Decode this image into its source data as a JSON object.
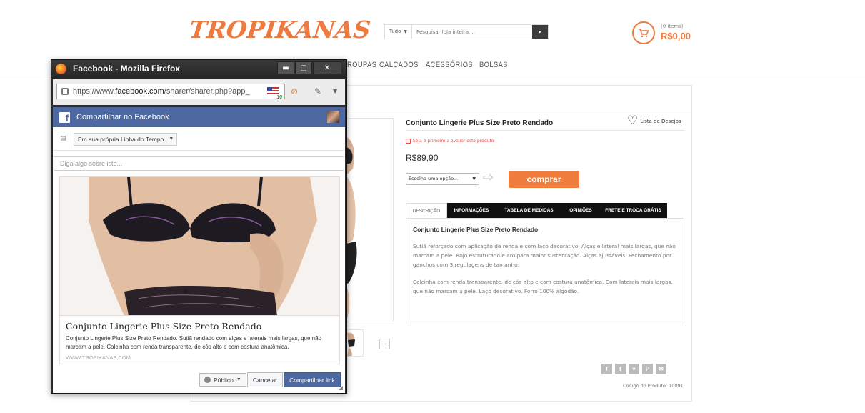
{
  "store": {
    "logo": "TROPIKANAS",
    "search": {
      "category": "Tudo",
      "placeholder": "Pesquisar loja inteira ..."
    },
    "cart": {
      "count_label": "(0 items)",
      "total": "R$0,00"
    },
    "nav": [
      "ROUPAS",
      "CALÇADOS",
      "ACESSÓRIOS",
      "BOLSAS"
    ]
  },
  "product": {
    "title": "Conjunto Lingerie Plus Size Preto Rendado",
    "wishlist_label": "Lista de Desejos",
    "rating_prompt": "Seja o primeiro a avaliar este produto",
    "price": "R$89,90",
    "variant_placeholder": "Escolha uma opção...",
    "buy_label": "comprar",
    "tabs": [
      {
        "label": "DESCRIÇÃO",
        "active": true
      },
      {
        "label": "INFORMAÇÕES",
        "active": false
      },
      {
        "label": "TABELA DE MEDIDAS",
        "active": false
      },
      {
        "label": "OPINIÕES",
        "active": false
      },
      {
        "label": "FRETE E TROCA GRÁTIS",
        "active": false
      }
    ],
    "description": {
      "title": "Conjunto Lingerie Plus Size Preto Rendado",
      "paragraphs": [
        "Sutiã reforçado com aplicação de renda e com laço decorativo. Alças e lateral mais largas, que não marcam a pele. Bojo estruturado e aro para maior sustentação. Alças ajustáveis. Fechamento por ganchos com 3 regulagens de tamanho.",
        "Calcinha com renda transparente, de cós alto e com costura anatômica. Com laterais mais largas, que não marcam a pele. Laço decorativo. Forro 100% algodão."
      ]
    },
    "code_label": "Código do Produto: 10091"
  },
  "popup": {
    "window_title": "Facebook - Mozilla Firefox",
    "url_prefix": "https://www.",
    "url_domain": "facebook.com",
    "url_rest": "/sharer/sharer.php?app_",
    "flag_badge": "10",
    "fb_header": "Compartilhar no Facebook",
    "target": "Em sua própria Linha do Tempo",
    "message_placeholder": "Diga algo sobre isto...",
    "preview_title": "Conjunto Lingerie Plus Size Preto Rendado",
    "preview_desc": "Conjunto Lingerie Plus Size Preto Rendado. Sutiã rendado com alças e laterais mais largas, que não marcam a pele. Calcinha com renda transparente, de cós alto e com costura anatômica.",
    "preview_url": "WWW.TROPIKANAS.COM",
    "audience": "Público",
    "cancel": "Cancelar",
    "share": "Compartilhar link"
  },
  "colors": {
    "brand_orange": "#ef7a3f",
    "facebook_blue": "#4e69a2",
    "tab_dark": "#111111"
  }
}
